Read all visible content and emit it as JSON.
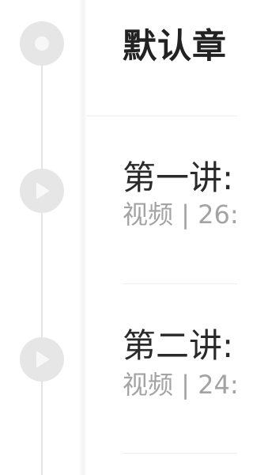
{
  "timeline": {
    "nodes": [
      {
        "type": "chapter",
        "icon": "circle-dot-icon"
      },
      {
        "type": "video",
        "icon": "play-icon"
      },
      {
        "type": "video",
        "icon": "play-icon"
      }
    ]
  },
  "chapter": {
    "title": "默认章"
  },
  "lessons": [
    {
      "title": "第一讲:",
      "meta": "视频 | 26:"
    },
    {
      "title": "第二讲:",
      "meta": "视频 | 24:"
    }
  ],
  "colors": {
    "node": "#e6e6e6",
    "title": "#222222",
    "meta": "#a3a3a3",
    "divider": "#eeeeee"
  }
}
